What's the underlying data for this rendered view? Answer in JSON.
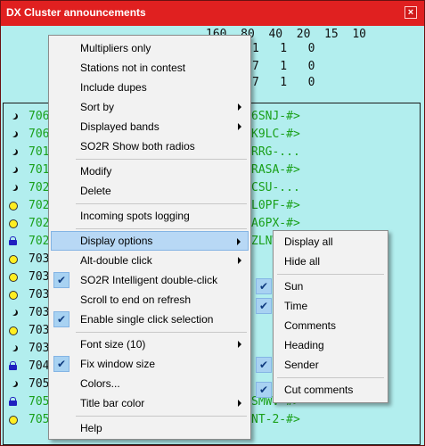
{
  "window": {
    "title": "DX Cluster announcements",
    "close_label": "×"
  },
  "summary": {
    "bands_header": "160  80  40  20  15  10",
    "rows": [
      "1   1   0",
      "7   1   0",
      "7   1   0"
    ]
  },
  "spots": [
    {
      "icon": "moon-icon",
      "freq": "706",
      "tail": "6SNJ-#>"
    },
    {
      "icon": "moon-icon",
      "freq": "706",
      "tail": "K9LC-#>"
    },
    {
      "icon": "moon-icon",
      "freq": "701",
      "tail": "RRG-..."
    },
    {
      "icon": "moon-icon",
      "freq": "701",
      "tail": "RASA-#>"
    },
    {
      "icon": "moon-icon",
      "freq": "702",
      "tail": "CSU-..."
    },
    {
      "icon": "sun-icon",
      "freq": "702",
      "tail": "L0PF-#>"
    },
    {
      "icon": "sun-icon",
      "freq": "702",
      "tail": "A6PX-#>"
    },
    {
      "icon": "lock-icon",
      "freq": "702",
      "tail": "ZLNW-#>"
    },
    {
      "icon": "sun-icon",
      "freq": "703",
      "tail": ""
    },
    {
      "icon": "sun-icon",
      "freq": "703",
      "tail": ""
    },
    {
      "icon": "sun-icon",
      "freq": "703",
      "tail": ""
    },
    {
      "icon": "moon-icon",
      "freq": "703",
      "tail": ""
    },
    {
      "icon": "sun-icon",
      "freq": "703",
      "tail": ""
    },
    {
      "icon": "moon-icon",
      "freq": "703",
      "tail": ""
    },
    {
      "icon": "lock-icon",
      "freq": "704",
      "tail": ""
    },
    {
      "icon": "moon-icon",
      "freq": "705",
      "tail": ""
    },
    {
      "icon": "lock-icon",
      "freq": "705",
      "tail": "SMWV-#>"
    },
    {
      "icon": "sun-icon",
      "freq": "705",
      "tail": "NT-2-#>"
    }
  ],
  "main_menu": {
    "multipliers_only": "Multipliers only",
    "stations_not_in_contest": "Stations not in contest",
    "include_dupes": "Include dupes",
    "sort_by": "Sort by",
    "displayed_bands": "Displayed bands",
    "so2r_show_both": "SO2R Show both radios",
    "modify": "Modify",
    "delete": "Delete",
    "incoming_spots_logging": "Incoming spots logging",
    "display_options": "Display options",
    "alt_double_click": "Alt-double click",
    "so2r_intelligent": "SO2R Intelligent double-click",
    "scroll_to_end": "Scroll to end on refresh",
    "enable_single_click": "Enable single click selection",
    "font_size": "Font size (10)",
    "fix_window_size": "Fix window size",
    "colors": "Colors...",
    "title_bar_color": "Title bar color",
    "help": "Help"
  },
  "sub_menu": {
    "display_all": "Display all",
    "hide_all": "Hide all",
    "sun": "Sun",
    "time": "Time",
    "comments": "Comments",
    "heading": "Heading",
    "sender": "Sender",
    "cut_comments": "Cut comments"
  },
  "check_glyph": "✔",
  "colors": {
    "titlebar": "#e02020",
    "background": "#b2eeee",
    "spot_text": "#1aa01a",
    "highlight": "#b8d8f5"
  }
}
